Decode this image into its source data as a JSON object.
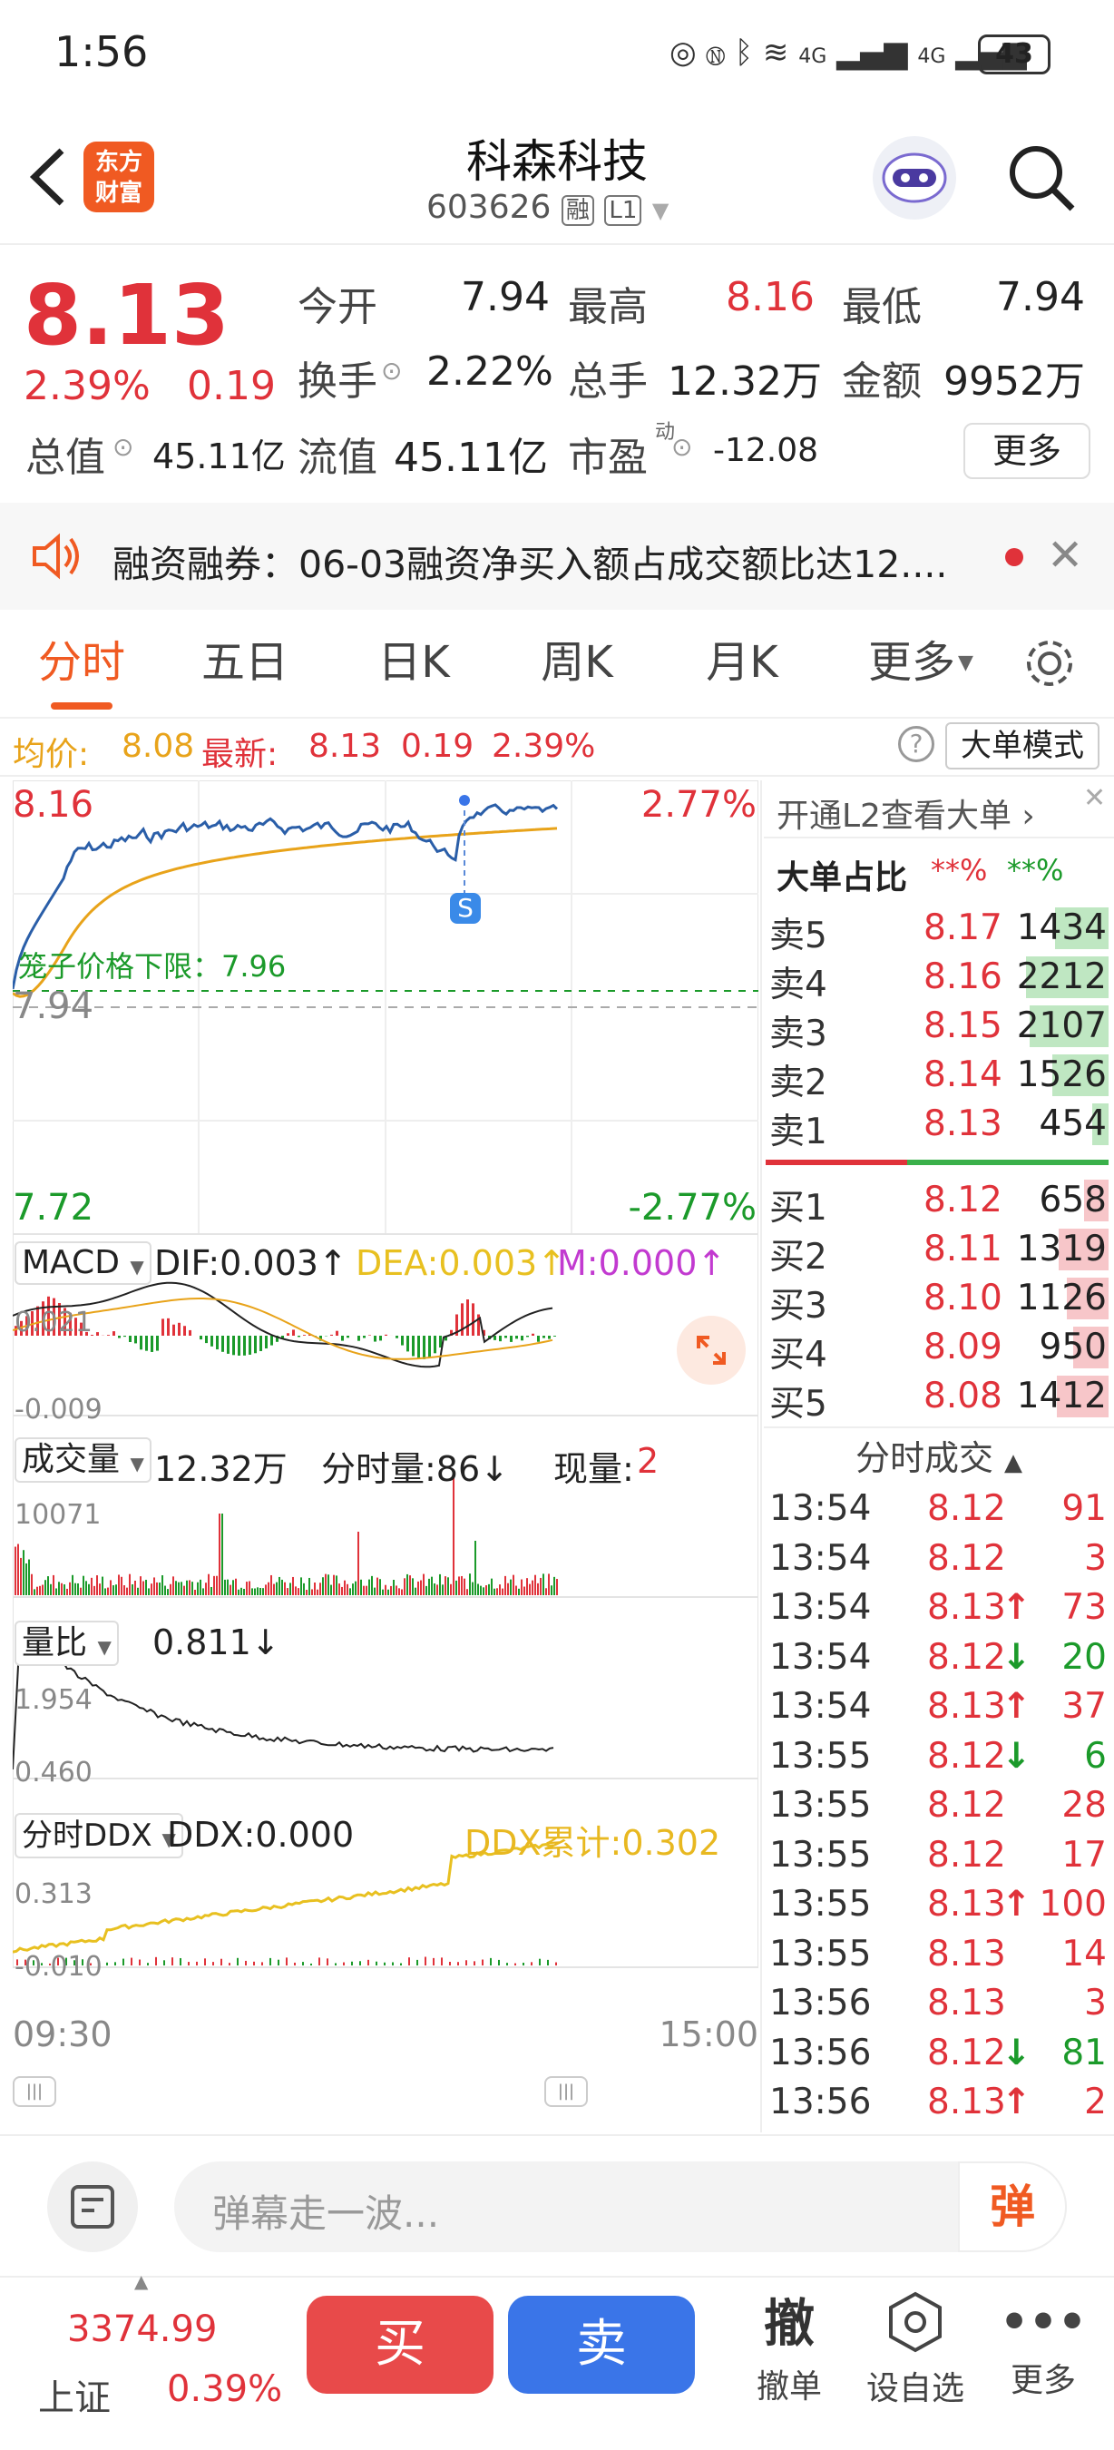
{
  "status": {
    "time": "1:56",
    "battery": "43",
    "net1": "4G",
    "net2": "4G",
    "wifi_sup": "6"
  },
  "nav": {
    "back": "back",
    "brand_line1": "东方",
    "brand_line2": "财富",
    "title": "科森科技",
    "code": "603626",
    "tag1": "融",
    "tag2": "L1"
  },
  "quote": {
    "price": "8.13",
    "pct": "2.39%",
    "chg": "0.19",
    "open_label": "今开",
    "open": "7.94",
    "high_label": "最高",
    "high": "8.16",
    "low_label": "最低",
    "low": "7.94",
    "turnover_label": "换手",
    "turnover": "2.22%",
    "vol_label": "总手",
    "vol": "12.32万",
    "amt_label": "金额",
    "amt": "9952万",
    "mcap_label": "总值",
    "mcap": "45.11亿",
    "float_label": "流值",
    "float": "45.11亿",
    "pe_label": "市盈",
    "pe_sup": "动",
    "pe": "-12.08",
    "more": "更多"
  },
  "notice": {
    "text": "融资融券：06-03融资净买入额占成交额比达12...."
  },
  "tabs": [
    "分时",
    "五日",
    "日K",
    "周K",
    "月K",
    "更多"
  ],
  "avg": {
    "avg_label": "均价:",
    "avg": "8.08",
    "last_label": "最新:",
    "last": "8.13",
    "chg": "0.19",
    "pct": "2.39%",
    "mode_btn": "大单模式"
  },
  "chart": {
    "price_top": "8.16",
    "pct_top": "2.77%",
    "limit_label": "笼子价格下限：7.96",
    "prev_close": "7.94",
    "price_bot": "7.72",
    "pct_bot": "-2.77%",
    "s_marker": "S",
    "macd_sel": "MACD",
    "dif": "DIF:0.003↑",
    "dea": "DEA:0.003↑",
    "m": "M:0.000↑",
    "macd_top": "0.021",
    "macd_bot": "-0.009",
    "vol_sel": "成交量",
    "vol_total": "12.32万",
    "vol_min": "分时量:86↓",
    "vol_now_label": "现量:",
    "vol_now": "2",
    "vol_max": "10071",
    "ratio_sel": "量比",
    "ratio": "0.811↓",
    "ratio_top": "1.954",
    "ratio_bot": "0.460",
    "ddx_sel": "分时DDX",
    "ddx": "DDX:0.000",
    "ddx_cum": "DDX累计:0.302",
    "ddx_top": "0.313",
    "ddx_bot": "-0.010",
    "time_start": "09:30",
    "time_end": "15:00"
  },
  "orderbook": {
    "l2_link": "开通L2查看大单",
    "big_label": "大单占比",
    "big_red": "**%",
    "big_green": "**%",
    "asks": [
      {
        "label": "卖5",
        "price": "8.17",
        "vol": "1434",
        "frac": 0.42
      },
      {
        "label": "卖4",
        "price": "8.16",
        "vol": "2212",
        "frac": 0.65
      },
      {
        "label": "卖3",
        "price": "8.15",
        "vol": "2107",
        "frac": 0.62
      },
      {
        "label": "卖2",
        "price": "8.14",
        "vol": "1526",
        "frac": 0.44
      },
      {
        "label": "卖1",
        "price": "8.13",
        "vol": "454",
        "frac": 0.13
      }
    ],
    "bids": [
      {
        "label": "买1",
        "price": "8.12",
        "vol": "658",
        "frac": 0.19
      },
      {
        "label": "买2",
        "price": "8.11",
        "vol": "1319",
        "frac": 0.39
      },
      {
        "label": "买3",
        "price": "8.10",
        "vol": "1126",
        "frac": 0.33
      },
      {
        "label": "买4",
        "price": "8.09",
        "vol": "950",
        "frac": 0.28
      },
      {
        "label": "买5",
        "price": "8.08",
        "vol": "1412",
        "frac": 0.41
      }
    ],
    "trades_title": "分时成交",
    "trades": [
      {
        "t": "13:54",
        "p": "8.12",
        "d": "",
        "v": "91"
      },
      {
        "t": "13:54",
        "p": "8.12",
        "d": "",
        "v": "3"
      },
      {
        "t": "13:54",
        "p": "8.13",
        "d": "↑",
        "v": "73"
      },
      {
        "t": "13:54",
        "p": "8.12",
        "d": "↓",
        "v": "20"
      },
      {
        "t": "13:54",
        "p": "8.13",
        "d": "↑",
        "v": "37"
      },
      {
        "t": "13:55",
        "p": "8.12",
        "d": "↓",
        "v": "6"
      },
      {
        "t": "13:55",
        "p": "8.12",
        "d": "",
        "v": "28"
      },
      {
        "t": "13:55",
        "p": "8.12",
        "d": "",
        "v": "17"
      },
      {
        "t": "13:55",
        "p": "8.13",
        "d": "↑",
        "v": "100"
      },
      {
        "t": "13:55",
        "p": "8.13",
        "d": "",
        "v": "14"
      },
      {
        "t": "13:56",
        "p": "8.13",
        "d": "",
        "v": "3"
      },
      {
        "t": "13:56",
        "p": "8.12",
        "d": "↓",
        "v": "81"
      },
      {
        "t": "13:56",
        "p": "8.13",
        "d": "↑",
        "v": "2"
      }
    ]
  },
  "input": {
    "placeholder": "弹幕走一波...",
    "dan": "弹"
  },
  "bottom": {
    "index_val": "3374.99",
    "index_name": "上证",
    "index_pct": "0.39%",
    "buy": "买",
    "sell": "卖",
    "cancel_big": "撤",
    "cancel": "撤单",
    "warn": "设自选",
    "more": "更多"
  },
  "colors": {
    "up": "#e0323a",
    "down": "#1b9a2a",
    "accent": "#f05a22",
    "sell_btn": "#3a75e8",
    "buy_btn": "#e84a4a",
    "avg_line": "#e8a31a",
    "price_line": "#2a5ea8"
  }
}
